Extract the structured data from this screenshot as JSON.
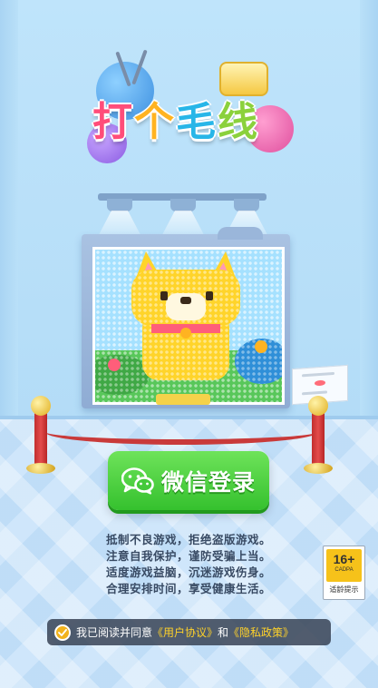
{
  "logo": {
    "text": [
      "打",
      "个",
      "毛",
      "线"
    ]
  },
  "login": {
    "button_label": "微信登录",
    "icon": "wechat-icon"
  },
  "advisory": {
    "lines": [
      "抵制不良游戏，拒绝盗版游戏。",
      "注意自我保护，谨防受骗上当。",
      "适度游戏益脑，沉迷游戏伤身。",
      "合理安排时间，享受健康生活。"
    ]
  },
  "age_rating": {
    "rating": "16+",
    "org": "CADPA",
    "label": "适龄提示"
  },
  "agreement": {
    "prefix": "我已阅读并同意",
    "user_agreement": "《用户协议》",
    "conjunction": "和",
    "privacy_policy": "《隐私政策》",
    "checked": true
  },
  "colors": {
    "wechat_green": "#35c12e",
    "link_yellow": "#ffd22a",
    "background": "#bfe3fa"
  }
}
